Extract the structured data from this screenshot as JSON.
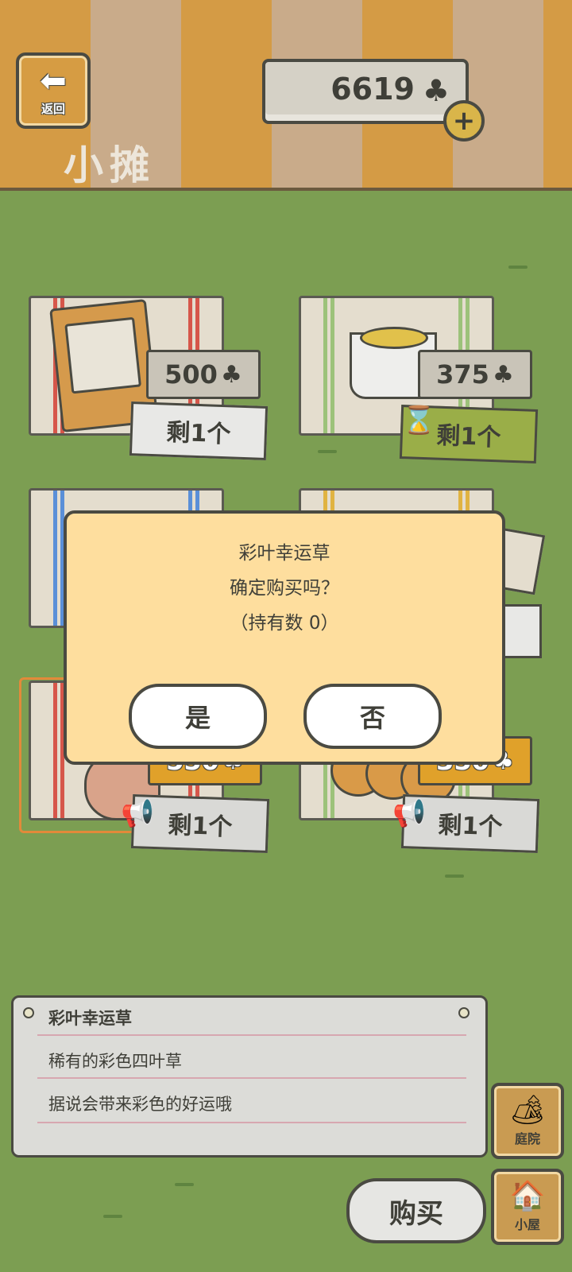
{
  "header": {
    "back_label": "返回",
    "back_icon": "arrow-left-icon",
    "title": "小摊",
    "currency": {
      "value": "6619",
      "icon": "clover-icon",
      "plus": "+"
    }
  },
  "items": [
    {
      "price": "500",
      "stock": "剩1个",
      "art": "furniture-card"
    },
    {
      "price": "375",
      "stock": "剩1个",
      "art": "soup-pot",
      "timer": "hourglass-icon"
    },
    {
      "price": "550",
      "stock": "剩1个",
      "art": "four-leaf-clover",
      "promo": "megaphone-icon"
    },
    {
      "price": "350",
      "stock": "剩1个",
      "art": "pancakes",
      "promo": "megaphone-icon"
    }
  ],
  "dialog": {
    "line1": "彩叶幸运草",
    "line2": "确定购买吗？",
    "line3": "（持有数 0）",
    "yes": "是",
    "no": "否"
  },
  "description": {
    "name": "彩叶幸运草",
    "line1": "稀有的彩色四叶草",
    "line2": "据说会带来彩色的好运哦"
  },
  "buy_label": "购买",
  "side": {
    "yard_label": "庭院",
    "house_label": "小屋"
  },
  "colors": {
    "grass": "#7c9e52",
    "dialog_bg": "#fede9e",
    "gold": "#e0a12a",
    "outline": "#4a4a42"
  }
}
